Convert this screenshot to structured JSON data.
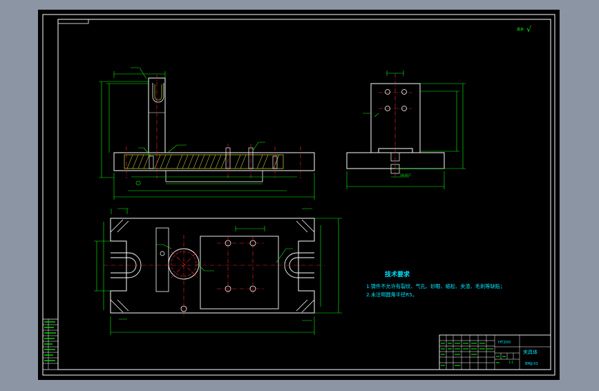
{
  "colors": {
    "background": "#000000",
    "chrome": "#8c95a4",
    "outline": "#ffffff",
    "dimension": "#00ff00",
    "centerline": "#ff2b2b",
    "hatch": "#ffff33",
    "annotation": "#00e5ff"
  },
  "roughness_note": "其余",
  "roughness_symbol": "√",
  "tech_requirements": {
    "title": "技术要求",
    "items": [
      "1.铸件不允许有裂纹、气孔、砂眼、缩松、夹渣、毛刺等缺陷；",
      "2.未注明圆角半径R5。"
    ]
  },
  "title_block": {
    "material": "HT200",
    "part_name": "夹具体",
    "drawing_no": "BMJJ-03",
    "scale": "1:1"
  },
  "side_view_dim": "18.817"
}
